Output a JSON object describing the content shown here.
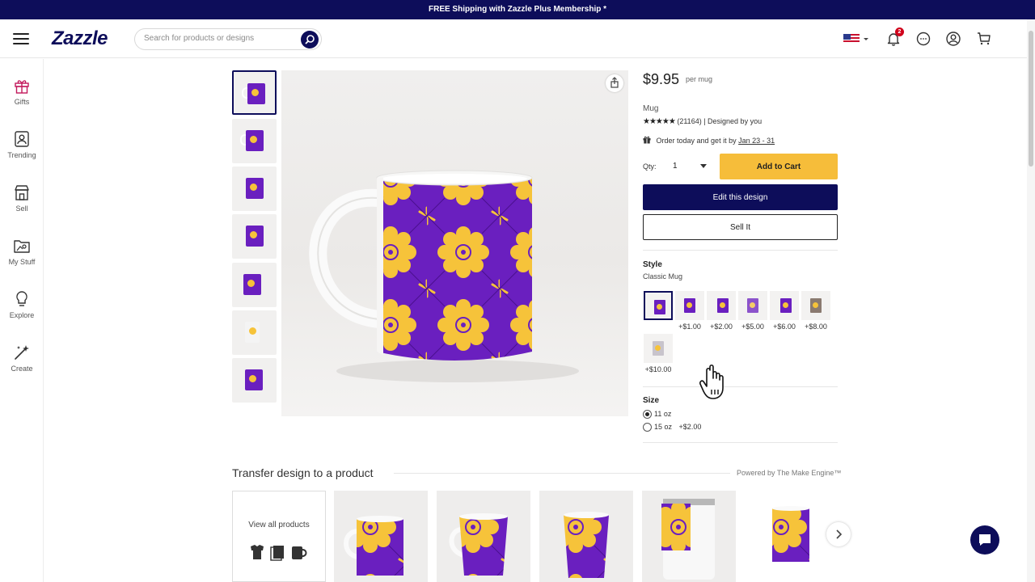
{
  "promo_banner": "FREE Shipping with Zazzle Plus Membership *",
  "header": {
    "logo": "Zazzle",
    "search_placeholder": "Search for products or designs",
    "notification_count": "2"
  },
  "sidebar": {
    "items": [
      {
        "label": "Gifts",
        "icon": "gift-icon"
      },
      {
        "label": "Trending",
        "icon": "trending-icon"
      },
      {
        "label": "Sell",
        "icon": "store-icon"
      },
      {
        "label": "My Stuff",
        "icon": "folder-icon"
      },
      {
        "label": "Explore",
        "icon": "lightbulb-icon"
      },
      {
        "label": "Create",
        "icon": "magic-wand-icon"
      }
    ]
  },
  "product": {
    "price": "$9.95",
    "price_unit": "per mug",
    "type": "Mug",
    "stars": "★★★★★",
    "rating_text": "(21164) | Designed by you",
    "order_text": "Order today and get it by",
    "delivery_date": "Jan 23 - 31",
    "qty_label": "Qty:",
    "qty_value": "1",
    "add_to_cart": "Add to Cart",
    "edit_design": "Edit this design",
    "sell_it": "Sell It"
  },
  "style": {
    "title": "Style",
    "selected": "Classic Mug",
    "options": [
      {
        "price": ""
      },
      {
        "price": "+$1.00"
      },
      {
        "price": "+$2.00"
      },
      {
        "price": "+$5.00"
      },
      {
        "price": "+$6.00"
      },
      {
        "price": "+$8.00"
      },
      {
        "price": "+$10.00"
      }
    ]
  },
  "size": {
    "title": "Size",
    "options": [
      {
        "label": "11 oz",
        "extra": "",
        "selected": true
      },
      {
        "label": "15 oz",
        "extra": "+$2.00",
        "selected": false
      }
    ]
  },
  "transfer": {
    "title": "Transfer design to a product",
    "powered_by": "Powered by The Make Engine™",
    "view_all": "View all products"
  },
  "colors": {
    "brand_navy": "#0d0d5a",
    "cart_yellow": "#f6bd3a",
    "mug_purple": "#6a1fbf",
    "flower_yellow": "#f6c33a"
  }
}
